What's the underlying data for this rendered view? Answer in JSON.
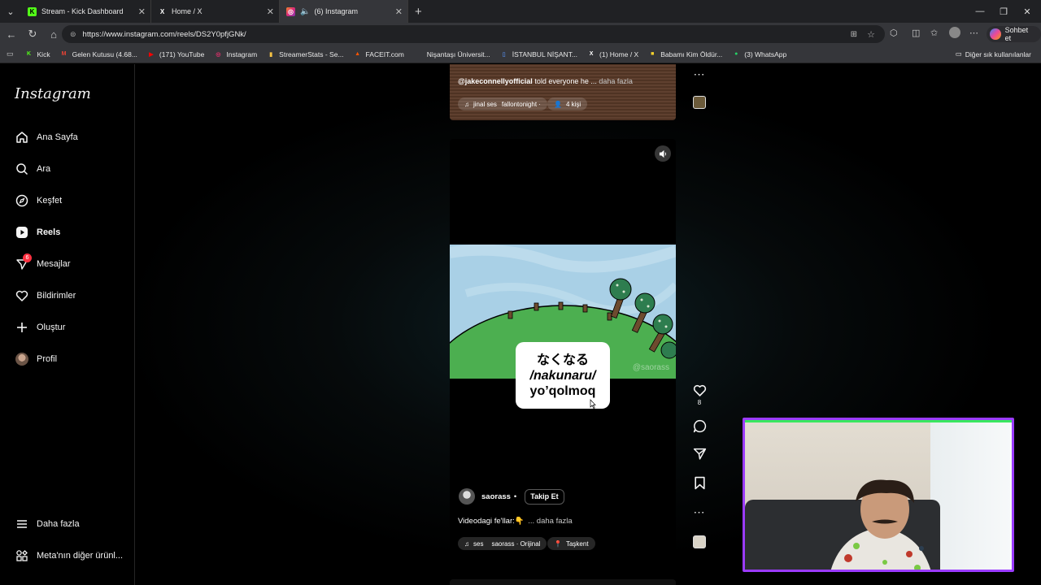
{
  "browser": {
    "tabs": [
      {
        "title": "Stream - Kick Dashboard",
        "favicon": "K",
        "favicon_color": "#53fc18"
      },
      {
        "title": "Home / X",
        "favicon": "X",
        "favicon_color": "#ffffff"
      },
      {
        "title": "(6) Instagram",
        "favicon": "ig",
        "favicon_color": "#e1306c",
        "active": true
      }
    ],
    "url": "https://www.instagram.com/reels/DS2Y0pfjGNk/",
    "copilot_label": "Sohbet et",
    "bookmarks": [
      {
        "label": "Kick",
        "icon": "K",
        "color": "#53fc18"
      },
      {
        "label": "Gelen Kutusu (4.68...",
        "icon": "M",
        "color": "#ea4335"
      },
      {
        "label": "(171) YouTube",
        "icon": "▶",
        "color": "#ff0000"
      },
      {
        "label": "Instagram",
        "icon": "◎",
        "color": "#e1306c"
      },
      {
        "label": "StreamerStats - Se...",
        "icon": "▮",
        "color": "#f6c344"
      },
      {
        "label": "FACEIT.com",
        "icon": "▲",
        "color": "#ff5500"
      },
      {
        "label": "Nişantaşı Üniversit...",
        "icon": "",
        "color": "#35363a"
      },
      {
        "label": "İSTANBUL NİŞANT...",
        "icon": "▯",
        "color": "#4f7dc9"
      },
      {
        "label": "(1) Home / X",
        "icon": "X",
        "color": "#ffffff"
      },
      {
        "label": "Babamı Kim Öldür...",
        "icon": "■",
        "color": "#f6d32d"
      },
      {
        "label": "(3) WhatsApp",
        "icon": "●",
        "color": "#25d366"
      }
    ],
    "other_bookmarks": "Diğer sık kullanılanlar"
  },
  "sidebar": {
    "logo": "Instagram",
    "items": [
      {
        "label": "Ana Sayfa",
        "icon": "home-icon"
      },
      {
        "label": "Ara",
        "icon": "search-icon"
      },
      {
        "label": "Keşfet",
        "icon": "compass-icon"
      },
      {
        "label": "Reels",
        "icon": "reels-icon"
      },
      {
        "label": "Mesajlar",
        "icon": "messages-icon",
        "badge": "6"
      },
      {
        "label": "Bildirimler",
        "icon": "heart-icon"
      },
      {
        "label": "Oluştur",
        "icon": "plus-icon"
      },
      {
        "label": "Profil",
        "icon": "avatar"
      }
    ],
    "more": "Daha fazla",
    "meta": "Meta'nın diğer ürünl..."
  },
  "prev_reel": {
    "username": "@jakeconnellyofficial",
    "caption": "told everyone he ...",
    "more": "daha fazla",
    "audio": "jinal ses",
    "audio_source": "fallontonight ·",
    "tagged": "4 kişi"
  },
  "reel": {
    "subtitle_jp": "なくなる",
    "subtitle_romaji": "/nakunaru/",
    "subtitle_uz": "yo’qolmoq",
    "watermark": "@saorass",
    "username": "saorass",
    "dot": "•",
    "follow": "Takip Et",
    "caption": "Videodagi fe'llar:👇",
    "more": "... daha fazla",
    "audio_prefix": "ses",
    "audio": "saorass · Orijinal",
    "location": "Taşkent"
  },
  "actions": {
    "like_count": "8"
  },
  "colors": {
    "accent_badge": "#ff3040",
    "webcam_border": "#9b3bff",
    "webcam_accent": "#39e75f",
    "grass": "#4caf50",
    "sky": "#a9d0e6"
  }
}
